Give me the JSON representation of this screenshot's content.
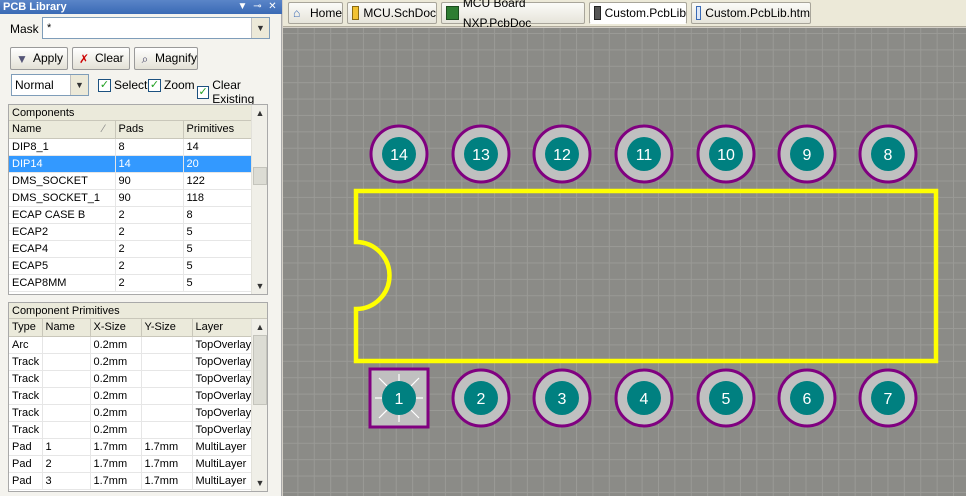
{
  "panel": {
    "title": "PCB Library",
    "mask_label": "Mask",
    "mask_value": "*",
    "buttons": {
      "apply": "Apply",
      "clear": "Clear",
      "magnify": "Magnify"
    },
    "mode": "Normal",
    "checkboxes": [
      {
        "label": "Select",
        "checked": true
      },
      {
        "label": "Zoom",
        "checked": true
      },
      {
        "label": "Clear Existing",
        "checked": true
      }
    ]
  },
  "components": {
    "title": "Components",
    "columns": [
      "Name",
      "Pads",
      "Primitives"
    ],
    "rows": [
      [
        "DIP8_1",
        "8",
        "14"
      ],
      [
        "DIP14",
        "14",
        "20"
      ],
      [
        "DMS_SOCKET",
        "90",
        "122"
      ],
      [
        "DMS_SOCKET_1",
        "90",
        "118"
      ],
      [
        "ECAP CASE B",
        "2",
        "8"
      ],
      [
        "ECAP2",
        "2",
        "5"
      ],
      [
        "ECAP4",
        "2",
        "5"
      ],
      [
        "ECAP5",
        "2",
        "5"
      ],
      [
        "ECAP8MM",
        "2",
        "5"
      ]
    ],
    "selected_row": 1
  },
  "primitives": {
    "title": "Component Primitives",
    "columns": [
      "Type",
      "Name",
      "X-Size",
      "Y-Size",
      "Layer"
    ],
    "rows": [
      [
        "Arc",
        "",
        "0.2mm",
        "",
        "TopOverlay"
      ],
      [
        "Track",
        "",
        "0.2mm",
        "",
        "TopOverlay"
      ],
      [
        "Track",
        "",
        "0.2mm",
        "",
        "TopOverlay"
      ],
      [
        "Track",
        "",
        "0.2mm",
        "",
        "TopOverlay"
      ],
      [
        "Track",
        "",
        "0.2mm",
        "",
        "TopOverlay"
      ],
      [
        "Track",
        "",
        "0.2mm",
        "",
        "TopOverlay"
      ],
      [
        "Pad",
        "1",
        "1.7mm",
        "1.7mm",
        "MultiLayer"
      ],
      [
        "Pad",
        "2",
        "1.7mm",
        "1.7mm",
        "MultiLayer"
      ],
      [
        "Pad",
        "3",
        "1.7mm",
        "1.7mm",
        "MultiLayer"
      ]
    ]
  },
  "tabs": [
    "Home",
    "MCU.SchDoc",
    "MCU Board NXP.PcbDoc",
    "Custom.PcbLib",
    "Custom.PcbLib.htm"
  ],
  "footprint": {
    "top_pads": [
      "14",
      "13",
      "12",
      "11",
      "10",
      "9",
      "8"
    ],
    "bottom_pads": [
      "1",
      "2",
      "3",
      "4",
      "5",
      "6",
      "7"
    ],
    "colors": {
      "overlay": "#ffff00",
      "pad_ring": "#c0c0c0",
      "pad_outline": "#800080",
      "pad_hole": "#008080",
      "pad1_square": "#c0c0c0",
      "background": "#8b8b87"
    }
  }
}
